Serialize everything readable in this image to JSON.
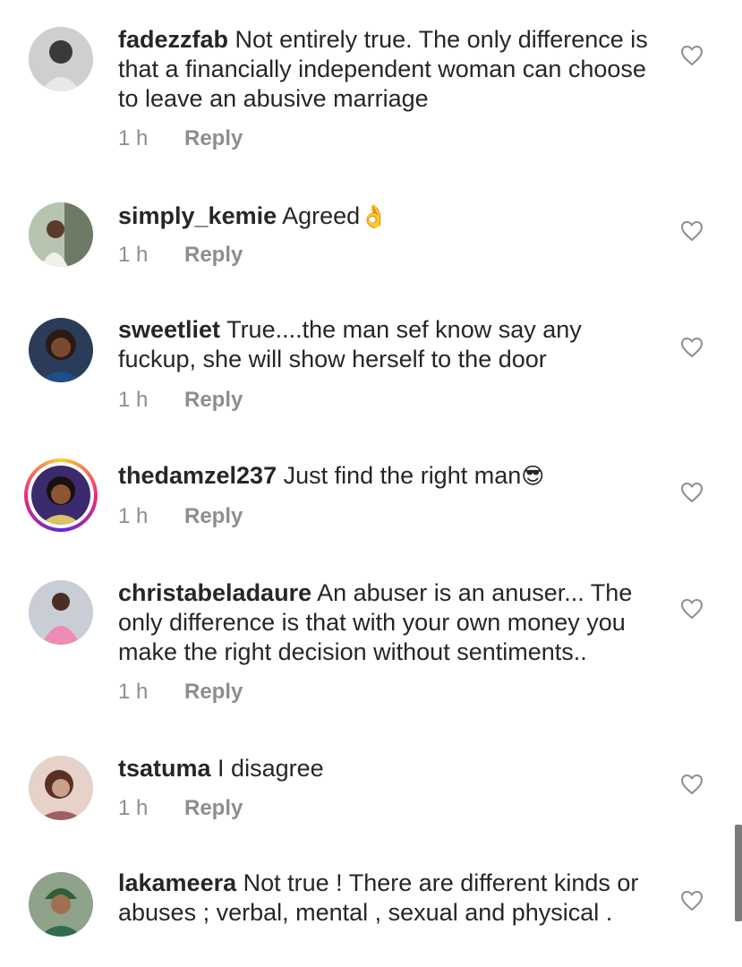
{
  "comments": [
    {
      "username": "fadezzfab",
      "text": "Not entirely true. The only difference is that a financially independent woman can choose to leave an abusive marriage",
      "time": "1 h",
      "reply": "Reply",
      "emoji": ""
    },
    {
      "username": "simply_kemie",
      "text": "Agreed",
      "time": "1 h",
      "reply": "Reply",
      "emoji": "👌"
    },
    {
      "username": "sweetliet",
      "text": "True....the man sef know say any fuckup, she will show herself to the door",
      "time": "1 h",
      "reply": "Reply",
      "emoji": ""
    },
    {
      "username": "thedamzel237",
      "text": "Just find the right man",
      "time": "1 h",
      "reply": "Reply",
      "emoji": "😎"
    },
    {
      "username": "christabeladaure",
      "text": "An abuser is an anuser... The only difference is that with your own money you make the right decision without sentiments..",
      "time": "1 h",
      "reply": "Reply",
      "emoji": ""
    },
    {
      "username": "tsatuma",
      "text": "I disagree",
      "time": "1 h",
      "reply": "Reply",
      "emoji": ""
    },
    {
      "username": "lakameera",
      "text": "Not true ! There are different kinds or abuses ; verbal, mental , sexual and physical .",
      "time": "",
      "reply": "",
      "emoji": ""
    }
  ],
  "icons": {
    "like": "heart-outline-icon"
  },
  "colors": {
    "text": "#262626",
    "meta": "#8e8e8e",
    "story_ring": [
      "#f9ce34",
      "#ee2a7b",
      "#6228d7"
    ]
  }
}
